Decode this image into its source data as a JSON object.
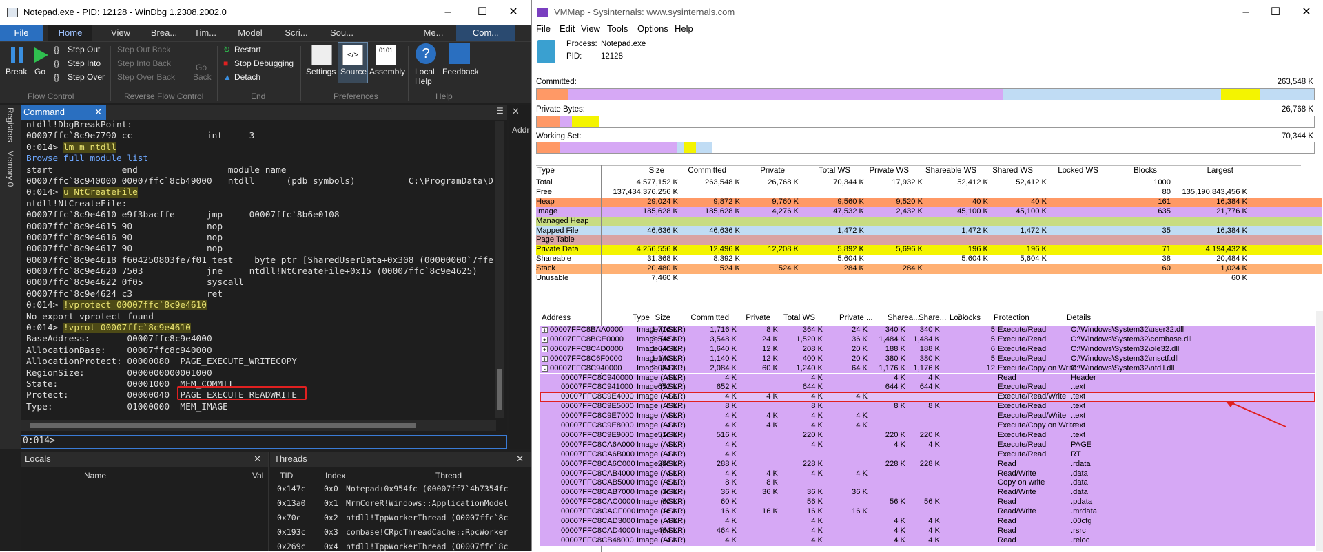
{
  "windbg": {
    "title": "Notepad.exe - PID: 12128 - WinDbg 1.2308.2002.0",
    "tabs": [
      "File",
      "Home",
      "View",
      "Brea...",
      "Tim...",
      "Model",
      "Scri...",
      "Sou...",
      "Me...",
      "Com..."
    ],
    "ribbon": {
      "break": "Break",
      "go": "Go",
      "step_out": "Step Out",
      "step_into": "Step Into",
      "step_over": "Step Over",
      "step_out_back": "Step Out Back",
      "step_into_back": "Step Into Back",
      "step_over_back": "Step Over Back",
      "go_back": "Go Back",
      "restart": "Restart",
      "stop": "Stop Debugging",
      "detach": "Detach",
      "settings": "Settings",
      "source": "Source",
      "assembly": "Assembly",
      "local_help": "Local Help",
      "feedback": "Feedback",
      "groups": {
        "flow": "Flow Control",
        "reverse": "Reverse Flow Control",
        "end": "End",
        "prefs": "Preferences",
        "help": "Help"
      }
    },
    "command_tab": "Command",
    "sidebar": {
      "registers": "Registers",
      "memory": "Memory 0"
    },
    "output": [
      "ntdll!DbgBreakPoint:",
      "00007ffc`8c9e7790 cc              int     3",
      "0:014> lm m ntdll",
      "Browse full module list",
      "start             end                 module name",
      "00007ffc`8c940000 00007ffc`8cb49000   ntdll      (pdb symbols)          C:\\ProgramData\\D",
      "0:014> u NtCreateFile",
      "ntdll!NtCreateFile:",
      "00007ffc`8c9e4610 e9f3bacffe      jmp     00007ffc`8b6e0108",
      "00007ffc`8c9e4615 90              nop",
      "00007ffc`8c9e4616 90              nop",
      "00007ffc`8c9e4617 90              nop",
      "00007ffc`8c9e4618 f604250803fe7f01 test    byte ptr [SharedUserData+0x308 (00000000`7ffe",
      "00007ffc`8c9e4620 7503            jne     ntdll!NtCreateFile+0x15 (00007ffc`8c9e4625)",
      "00007ffc`8c9e4622 0f05            syscall",
      "00007ffc`8c9e4624 c3              ret",
      "0:014> !vprotect 00007ffc`8c9e4610",
      "No export vprotect found",
      "0:014> !vprot 00007ffc`8c9e4610",
      "BaseAddress:       00007ffc8c9e4000",
      "AllocationBase:    00007ffc8c940000",
      "AllocationProtect: 00000080  PAGE_EXECUTE_WRITECOPY",
      "RegionSize:        0000000000001000",
      "State:             00001000  MEM_COMMIT",
      "Protect:           00000040  PAGE_EXECUTE_READWRITE",
      "Type:              01000000  MEM_IMAGE"
    ],
    "prompt": "0:014>",
    "locals": {
      "title": "Locals",
      "col_name": "Name",
      "col_val": "Val"
    },
    "threads": {
      "title": "Threads",
      "cols": [
        "TID",
        "Index",
        "Thread"
      ],
      "rows": [
        [
          "0x147c",
          "0x0",
          "Notepad+0x954fc (00007ff7`4b7354fc"
        ],
        [
          "0x13a0",
          "0x1",
          "MrmCoreR!Windows::ApplicationModel"
        ],
        [
          "0x70c",
          "0x2",
          "ntdll!TppWorkerThread (00007ffc`8c"
        ],
        [
          "0x193c",
          "0x3",
          "combase!CRpcThreadCache::RpcWorker"
        ],
        [
          "0x269c",
          "0x4",
          "ntdll!TppWorkerThread (00007ffc`8c"
        ]
      ]
    },
    "addr_label": "Addr"
  },
  "vmmap": {
    "title": "VMMap - Sysinternals: www.sysinternals.com",
    "menu": [
      "File",
      "Edit",
      "View",
      "Tools",
      "Options",
      "Help"
    ],
    "process_label": "Process:",
    "process": "Notepad.exe",
    "pid_label": "PID:",
    "pid": "12128",
    "committed_label": "Committed:",
    "committed": "263,548 K",
    "private_label": "Private Bytes:",
    "private": "26,768 K",
    "ws_label": "Working Set:",
    "ws": "70,344 K",
    "colors": {
      "image": "#d6a8f5",
      "heap": "#ff9966",
      "mapped": "#c0dcf4",
      "private": "#f4f400",
      "shareable": "#ffffff",
      "stack": "#ffb073",
      "managed": "#c8dc82",
      "pagetable": "#d9a3a3"
    },
    "summary_cols": [
      "Type",
      "Size",
      "Committed",
      "Private",
      "Total WS",
      "Private WS",
      "Shareable WS",
      "Shared WS",
      "Locked WS",
      "Blocks",
      "Largest"
    ],
    "summary": [
      {
        "t": "Total",
        "v": [
          "4,577,152 K",
          "263,548 K",
          "26,768 K",
          "70,344 K",
          "17,932 K",
          "52,412 K",
          "52,412 K",
          "",
          "1000",
          ""
        ],
        "c": "#ffffff"
      },
      {
        "t": "Free",
        "v": [
          "137,434,376,256 K",
          "",
          "",
          "",
          "",
          "",
          "",
          "",
          "80",
          "135,190,843,456 K"
        ],
        "c": "#ffffff"
      },
      {
        "t": "Heap",
        "v": [
          "29,024 K",
          "9,872 K",
          "9,760 K",
          "9,560 K",
          "9,520 K",
          "40 K",
          "40 K",
          "",
          "161",
          "16,384 K"
        ],
        "c": "#ff9966"
      },
      {
        "t": "Image",
        "v": [
          "185,628 K",
          "185,628 K",
          "4,276 K",
          "47,532 K",
          "2,432 K",
          "45,100 K",
          "45,100 K",
          "",
          "635",
          "21,776 K"
        ],
        "c": "#d6a8f5"
      },
      {
        "t": "Managed Heap",
        "v": [
          "",
          "",
          "",
          "",
          "",
          "",
          "",
          "",
          "",
          ""
        ],
        "c": "#c8dc82"
      },
      {
        "t": "Mapped File",
        "v": [
          "46,636 K",
          "46,636 K",
          "",
          "1,472 K",
          "",
          "1,472 K",
          "1,472 K",
          "",
          "35",
          "16,384 K"
        ],
        "c": "#c0dcf4"
      },
      {
        "t": "Page Table",
        "v": [
          "",
          "",
          "",
          "",
          "",
          "",
          "",
          "",
          "",
          ""
        ],
        "c": "#d9a3a3"
      },
      {
        "t": "Private Data",
        "v": [
          "4,256,556 K",
          "12,496 K",
          "12,208 K",
          "5,892 K",
          "5,696 K",
          "196 K",
          "196 K",
          "",
          "71",
          "4,194,432 K"
        ],
        "c": "#f4f400"
      },
      {
        "t": "Shareable",
        "v": [
          "31,368 K",
          "8,392 K",
          "",
          "5,604 K",
          "",
          "5,604 K",
          "5,604 K",
          "",
          "38",
          "20,484 K"
        ],
        "c": "#ffffff"
      },
      {
        "t": "Stack",
        "v": [
          "20,480 K",
          "524 K",
          "524 K",
          "284 K",
          "284 K",
          "",
          "",
          "",
          "60",
          "1,024 K"
        ],
        "c": "#ffb073"
      },
      {
        "t": "Unusable",
        "v": [
          "7,460 K",
          "",
          "",
          "",
          "",
          "",
          "",
          "",
          "",
          "60 K"
        ],
        "c": "#ffffff"
      }
    ],
    "detail_cols": [
      "Address",
      "Type",
      "Size",
      "Committed",
      "Private",
      "Total WS",
      "Private ...",
      "Sharea...",
      "Share...",
      "Lock...",
      "Blocks",
      "Protection",
      "Details"
    ],
    "details": [
      {
        "e": "+",
        "a": "00007FFC8BAA0000",
        "ty": "Image (ASLR)",
        "v": [
          "1,716 K",
          "1,716 K",
          "8 K",
          "364 K",
          "24 K",
          "340 K",
          "340 K",
          "",
          "5"
        ],
        "p": "Execute/Read",
        "d": "C:\\Windows\\System32\\user32.dll"
      },
      {
        "e": "+",
        "a": "00007FFC8BCE0000",
        "ty": "Image (ASLR)",
        "v": [
          "3,548 K",
          "3,548 K",
          "24 K",
          "1,520 K",
          "36 K",
          "1,484 K",
          "1,484 K",
          "",
          "5"
        ],
        "p": "Execute/Read",
        "d": "C:\\Windows\\System32\\combase.dll"
      },
      {
        "e": "+",
        "a": "00007FFC8C4D0000",
        "ty": "Image (ASLR)",
        "v": [
          "1,640 K",
          "1,640 K",
          "12 K",
          "208 K",
          "20 K",
          "188 K",
          "188 K",
          "",
          "6"
        ],
        "p": "Execute/Read",
        "d": "C:\\Windows\\System32\\ole32.dll"
      },
      {
        "e": "+",
        "a": "00007FFC8C6F0000",
        "ty": "Image (ASLR)",
        "v": [
          "1,140 K",
          "1,140 K",
          "12 K",
          "400 K",
          "20 K",
          "380 K",
          "380 K",
          "",
          "5"
        ],
        "p": "Execute/Read",
        "d": "C:\\Windows\\System32\\msctf.dll"
      },
      {
        "e": "-",
        "a": "00007FFC8C940000",
        "ty": "Image (ASLR)",
        "v": [
          "2,084 K",
          "2,084 K",
          "60 K",
          "1,240 K",
          "64 K",
          "1,176 K",
          "1,176 K",
          "",
          "12"
        ],
        "p": "Execute/Copy on Write",
        "d": "C:\\Windows\\System32\\ntdll.dll"
      },
      {
        "e": "",
        "a": "00007FFC8C940000",
        "ty": "Image (ASLR)",
        "v": [
          "4 K",
          "4 K",
          "",
          "4 K",
          "",
          "4 K",
          "4 K",
          "",
          ""
        ],
        "p": "Read",
        "d": "Header"
      },
      {
        "e": "",
        "a": "00007FFC8C941000",
        "ty": "Image (ASLR)",
        "v": [
          "652 K",
          "652 K",
          "",
          "644 K",
          "",
          "644 K",
          "644 K",
          "",
          ""
        ],
        "p": "Execute/Read",
        "d": ".text"
      },
      {
        "e": "",
        "a": "00007FFC8C9E4000",
        "ty": "Image (ASLR)",
        "v": [
          "4 K",
          "4 K",
          "4 K",
          "4 K",
          "4 K",
          "",
          "",
          "",
          ""
        ],
        "p": "Execute/Read/Write",
        "d": ".text",
        "sel": true
      },
      {
        "e": "",
        "a": "00007FFC8C9E5000",
        "ty": "Image (ASLR)",
        "v": [
          "8 K",
          "8 K",
          "",
          "8 K",
          "",
          "8 K",
          "8 K",
          "",
          ""
        ],
        "p": "Execute/Read",
        "d": ".text"
      },
      {
        "e": "",
        "a": "00007FFC8C9E7000",
        "ty": "Image (ASLR)",
        "v": [
          "4 K",
          "4 K",
          "4 K",
          "4 K",
          "4 K",
          "",
          "",
          "",
          ""
        ],
        "p": "Execute/Read/Write",
        "d": ".text"
      },
      {
        "e": "",
        "a": "00007FFC8C9E8000",
        "ty": "Image (ASLR)",
        "v": [
          "4 K",
          "4 K",
          "4 K",
          "4 K",
          "4 K",
          "",
          "",
          "",
          ""
        ],
        "p": "Execute/Copy on Write",
        "d": ".text"
      },
      {
        "e": "",
        "a": "00007FFC8C9E9000",
        "ty": "Image (ASLR)",
        "v": [
          "516 K",
          "516 K",
          "",
          "220 K",
          "",
          "220 K",
          "220 K",
          "",
          ""
        ],
        "p": "Execute/Read",
        "d": ".text"
      },
      {
        "e": "",
        "a": "00007FFC8CA6A000",
        "ty": "Image (ASLR)",
        "v": [
          "4 K",
          "4 K",
          "",
          "4 K",
          "",
          "4 K",
          "4 K",
          "",
          ""
        ],
        "p": "Execute/Read",
        "d": "PAGE"
      },
      {
        "e": "",
        "a": "00007FFC8CA6B000",
        "ty": "Image (ASLR)",
        "v": [
          "4 K",
          "4 K",
          "",
          "",
          "",
          "",
          "",
          "",
          ""
        ],
        "p": "Execute/Read",
        "d": "RT"
      },
      {
        "e": "",
        "a": "00007FFC8CA6C000",
        "ty": "Image (ASLR)",
        "v": [
          "288 K",
          "288 K",
          "",
          "228 K",
          "",
          "228 K",
          "228 K",
          "",
          ""
        ],
        "p": "Read",
        "d": ".rdata"
      },
      {
        "e": "",
        "a": "00007FFC8CAB4000",
        "ty": "Image (ASLR)",
        "v": [
          "4 K",
          "4 K",
          "4 K",
          "4 K",
          "4 K",
          "",
          "",
          "",
          ""
        ],
        "p": "Read/Write",
        "d": ".data"
      },
      {
        "e": "",
        "a": "00007FFC8CAB5000",
        "ty": "Image (ASLR)",
        "v": [
          "8 K",
          "8 K",
          "8 K",
          "",
          "",
          "",
          "",
          "",
          ""
        ],
        "p": "Copy on write",
        "d": ".data"
      },
      {
        "e": "",
        "a": "00007FFC8CAB7000",
        "ty": "Image (ASLR)",
        "v": [
          "36 K",
          "36 K",
          "36 K",
          "36 K",
          "36 K",
          "",
          "",
          "",
          ""
        ],
        "p": "Read/Write",
        "d": ".data"
      },
      {
        "e": "",
        "a": "00007FFC8CAC0000",
        "ty": "Image (ASLR)",
        "v": [
          "60 K",
          "60 K",
          "",
          "56 K",
          "",
          "56 K",
          "56 K",
          "",
          ""
        ],
        "p": "Read",
        "d": ".pdata"
      },
      {
        "e": "",
        "a": "00007FFC8CACF000",
        "ty": "Image (ASLR)",
        "v": [
          "16 K",
          "16 K",
          "16 K",
          "16 K",
          "16 K",
          "",
          "",
          "",
          ""
        ],
        "p": "Read/Write",
        "d": ".mrdata"
      },
      {
        "e": "",
        "a": "00007FFC8CAD3000",
        "ty": "Image (ASLR)",
        "v": [
          "4 K",
          "4 K",
          "",
          "4 K",
          "",
          "4 K",
          "4 K",
          "",
          ""
        ],
        "p": "Read",
        "d": ".00cfg"
      },
      {
        "e": "",
        "a": "00007FFC8CAD4000",
        "ty": "Image (ASLR)",
        "v": [
          "464 K",
          "464 K",
          "",
          "4 K",
          "",
          "4 K",
          "4 K",
          "",
          ""
        ],
        "p": "Read",
        "d": ".rsrc"
      },
      {
        "e": "",
        "a": "00007FFC8CB48000",
        "ty": "Image (ASLR)",
        "v": [
          "4 K",
          "4 K",
          "",
          "4 K",
          "",
          "4 K",
          "4 K",
          "",
          ""
        ],
        "p": "Read",
        "d": ".reloc"
      }
    ]
  }
}
